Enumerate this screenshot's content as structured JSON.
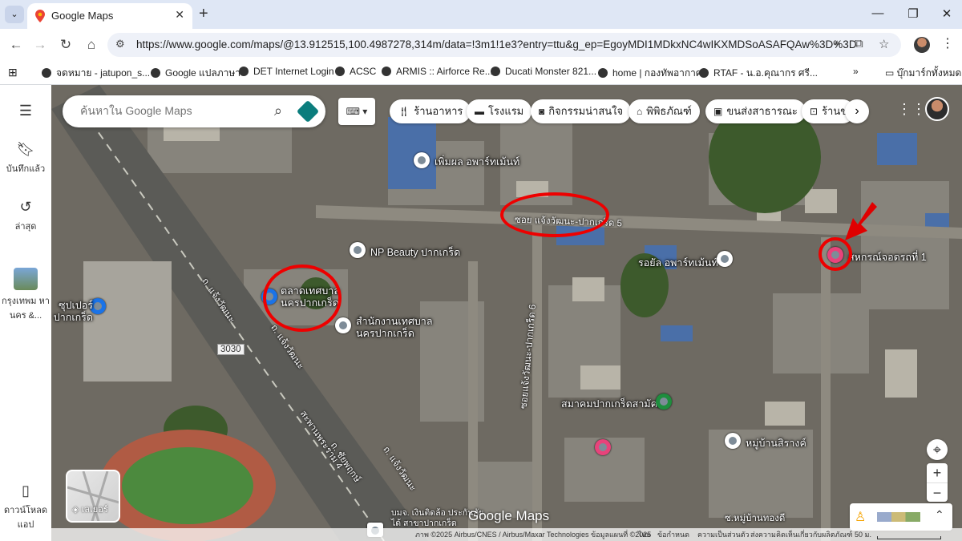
{
  "browser": {
    "tab_title": "Google Maps",
    "tab_close": "✕",
    "new_tab": "+",
    "menu": "⌄",
    "url": "https://www.google.com/maps/@13.912515,100.4987278,314m/data=!3m1!1e3?entry=ttu&g_ep=EgoyMDI1MDkxNC4wIKXMDSoASAFQAw%3D%3D",
    "window_controls": [
      "—",
      "❐",
      "✕"
    ]
  },
  "bookmarks": [
    "จดหมาย - jatupon_s...",
    "Google แปลภาษา",
    "DET Internet Login",
    "ACSC",
    "ARMIS :: Airforce Re...",
    "Ducati Monster 821...",
    "home | กองทัพอากาศ",
    "RTAF - น.อ.คุณากร ศรี...",
    "บุ๊กมาร์กทั้งหมด"
  ],
  "sidebar": {
    "saved": "บันทึกแล้ว",
    "recent": "ล่าสุด",
    "recent_place": "กรุงเทพม หานคร &...",
    "download": "ดาวน์โหลด แอป"
  },
  "search": {
    "placeholder": "ค้นหาใน Google Maps"
  },
  "chips": [
    "ร้านอาหาร",
    "โรงแรม",
    "กิจกรรมน่าสนใจ",
    "พิพิธภัณฑ์",
    "ขนส่งสาธารณะ",
    "ร้านข"
  ],
  "map_labels": {
    "poi_1": "เพิ่มผล อพาร์ทเม้นท์",
    "poi_2": "NP Beauty ปากเกร็ด",
    "poi_3": "ตลาดเทศบาล นครปากเกร็ด",
    "poi_4": "สำนักงานเทศบาล นครปากเกร็ด",
    "poi_5": "รอยัล อพาร์ทเม้นท์",
    "poi_6": "สหกรณ์จอดรถที่ 1",
    "poi_7": "สมาคมปากเกร็ดสามัคคี",
    "poi_8": "หมู่บ้านสิรางค์",
    "poi_9": "ซุปเปอร์ ปากเกร็ด",
    "road_1": "ซอย แจ้งวัฒนะ-ปากเกร็ด 5",
    "road_2": "ถ. แจ้งวัฒนะ",
    "road_3": "ถ. แจ้งวัฒนะ",
    "road_4": "สะพานพระราม 4",
    "road_5": "ถ. ชัยพฤกษ์",
    "road_6": "ถ. แจ้งวัฒนะ",
    "road_7": "ซอยแจ้งวัฒนะ-ปากเกร็ด 6",
    "road_8": "ซ.หมู่บ้านทองดี",
    "route_badge": "3030",
    "bottom_place": "บมจ. เงินติดล้อ ประกันภัยได้ สาขาปากเกร็ด"
  },
  "layers_label": "เลเยอร์",
  "watermark": "Google Maps",
  "footer": {
    "imagery": "ภาพ ©2025 Airbus/CNES / Airbus/Maxar Technologies ข้อมูลแผนที่ ©2025",
    "thailand": "ไทย",
    "terms": "ข้อกำหนด",
    "privacy": "ความเป็นส่วนตัว",
    "feedback": "ส่งความคิดเห็นเกี่ยวกับผลิตภัณฑ์",
    "scale": "50 ม."
  },
  "colors": {
    "annotation": "#e00000",
    "brand_blue": "#1a73e8"
  }
}
